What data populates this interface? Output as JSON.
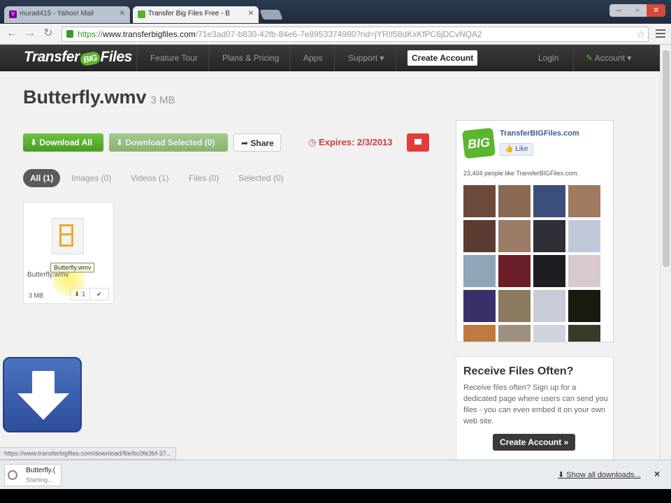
{
  "browser": {
    "tabs": [
      {
        "title": "murad415 - Yahoo! Mail",
        "active": false
      },
      {
        "title": "Transfer Big Files Free - B",
        "active": true
      }
    ],
    "url_scheme": "https://",
    "url_host": "www.transferbigfiles.com",
    "url_rest": "/71e3ad07-b830-42fb-84e6-7e8953374980?rid=jYRIf58dKxKfPC6jDCvNQA2",
    "status_url": "https://www.transferbigfiles.com/download/file/bc0fe3bf-37..."
  },
  "site_nav": {
    "logo_left": "Transfer",
    "logo_big": "BIG",
    "logo_right": "Files",
    "items": [
      "Feature Tour",
      "Plans & Pricing",
      "Apps",
      "Support"
    ],
    "create_account": "Create Account",
    "login": "Login",
    "account": "Account"
  },
  "file": {
    "title": "Butterfly.wmv",
    "size": "3 MB"
  },
  "actions": {
    "download_all": "Download All",
    "download_selected": "Download Selected (0)",
    "share": "Share",
    "expires": "Expires: 2/3/2013"
  },
  "filters": [
    "All (1)",
    "Images (0)",
    "Videos (1)",
    "Files (0)",
    "Selected (0)"
  ],
  "file_card": {
    "name": "Butterfly.wmv",
    "tooltip": "Butterfly.wmv",
    "size": "3 MB",
    "download_count": "1"
  },
  "fb_widget": {
    "logo_text": "BIG",
    "page_name": "TransferBIGFiles.com",
    "like_label": "Like",
    "likes_text": "23,404 people like TransferBIGFiles.com.",
    "face_colors": [
      "#6b4a3a",
      "#8a6a55",
      "#3b4f7a",
      "#a07a60",
      "#5a3b30",
      "#9a7b66",
      "#2e2e36",
      "#c0c8d8",
      "#8fa6b8",
      "#6a1f28",
      "#1e1e22",
      "#d8c8d0",
      "#3b2f6a",
      "#8a7a60",
      "#c8ccd6",
      "#1a1a10",
      "#c07a40",
      "#a09080",
      "#d0d4dc",
      "#3a3a2a"
    ]
  },
  "receive": {
    "title": "Receive Files Often?",
    "body": "Receive files often? Sign up for a dedicated page where users can send you files - you can even embed it on your own web site.",
    "button": "Create Account »"
  },
  "download_shelf": {
    "item_name": "Butterfly.(",
    "item_status": "Starting...",
    "show_all": "Show all downloads...",
    "close": "×"
  }
}
